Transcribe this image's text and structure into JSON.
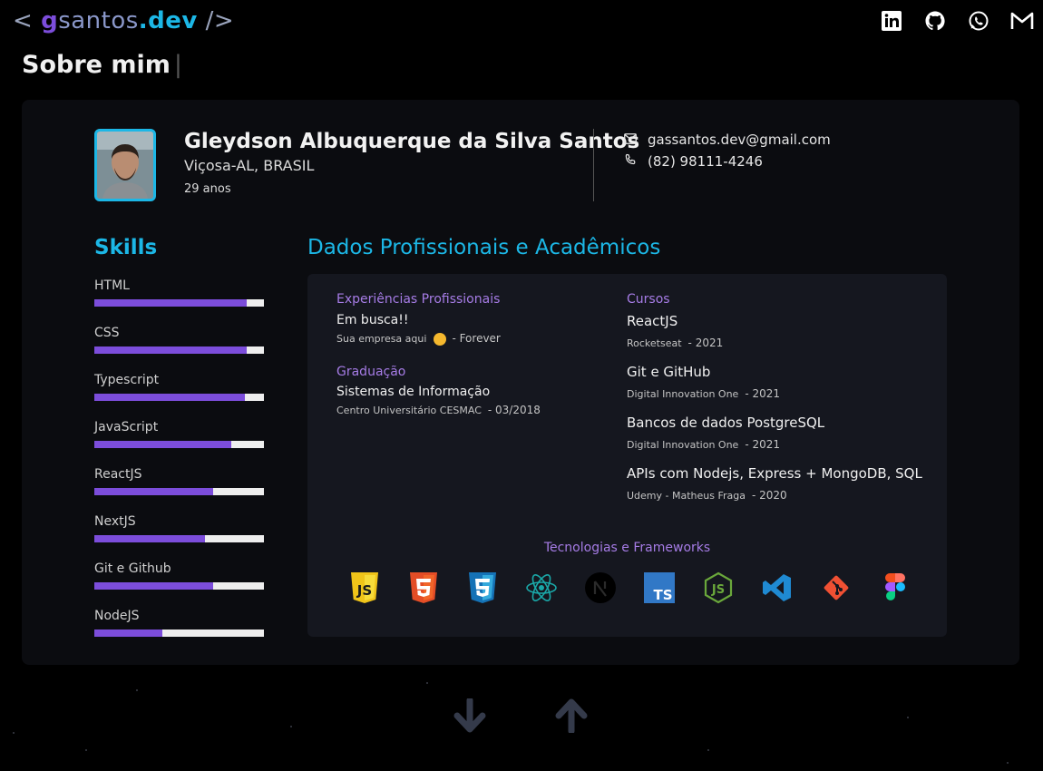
{
  "header": {
    "logo": {
      "open": "< ",
      "g": "g",
      "santos": "santos",
      "dev": ".dev",
      "close": " />"
    },
    "social_icons": [
      "linkedin-icon",
      "github-icon",
      "whatsapp-icon",
      "gmail-icon"
    ]
  },
  "page_title": "Sobre mim",
  "page_title_cursor": "|",
  "profile": {
    "name": "Gleydson Albuquerque da Silva Santos",
    "location": "Viçosa-AL, BRASIL",
    "age": "29 anos",
    "email": "gassantos.dev@gmail.com",
    "phone": "(82) 98111-4246"
  },
  "skills": {
    "title": "Skills",
    "items": [
      {
        "label": "HTML",
        "level": 0.9
      },
      {
        "label": "CSS",
        "level": 0.9
      },
      {
        "label": "Typescript",
        "level": 0.89
      },
      {
        "label": "JavaScript",
        "level": 0.81
      },
      {
        "label": "ReactJS",
        "level": 0.7
      },
      {
        "label": "NextJS",
        "level": 0.65
      },
      {
        "label": "Git e Github",
        "level": 0.7
      },
      {
        "label": "NodeJS",
        "level": 0.4
      }
    ]
  },
  "professional": {
    "title": "Dados Profissionais e Acadêmicos",
    "experience": {
      "heading": "Experiências Profissionais",
      "title": "Em busca!!",
      "company": "Sua empresa aqui",
      "period": "- Forever"
    },
    "graduation": {
      "heading": "Graduação",
      "title": "Sistemas de Informação",
      "institution": "Centro Universitário CESMAC",
      "period": "- 03/2018"
    },
    "courses": {
      "heading": "Cursos",
      "items": [
        {
          "title": "ReactJS",
          "provider": "Rocketseat",
          "year": "- 2021"
        },
        {
          "title": "Git e GitHub",
          "provider": "Digital Innovation One",
          "year": "- 2021"
        },
        {
          "title": "Bancos de dados PostgreSQL",
          "provider": "Digital Innovation One",
          "year": "- 2021"
        },
        {
          "title": "APIs com Nodejs, Express + MongoDB, SQL",
          "provider": "Udemy - Matheus Fraga",
          "year": "- 2020"
        }
      ]
    },
    "technologies": {
      "heading": "Tecnologias e Frameworks",
      "icons": [
        "javascript-icon",
        "html5-icon",
        "css3-icon",
        "react-icon",
        "nextjs-icon",
        "typescript-icon",
        "nodejs-icon",
        "vscode-icon",
        "git-icon",
        "figma-icon"
      ]
    }
  },
  "navigation": [
    "arrow-down-icon",
    "arrow-up-icon"
  ],
  "colors": {
    "accent_blue": "#1cb7e6",
    "accent_purple": "#7c4ddb",
    "section_purple": "#a67ce6",
    "background": "#000000",
    "card": "#0b0c10"
  }
}
